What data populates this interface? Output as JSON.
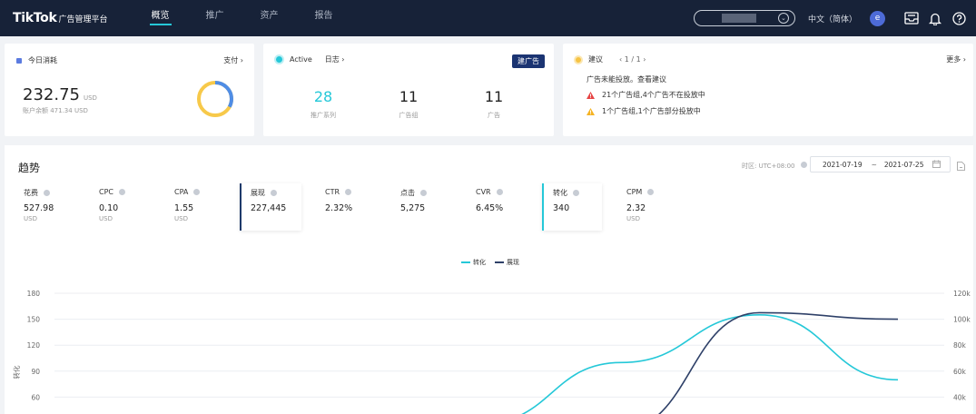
{
  "app": {
    "brand": "TikTok",
    "sub": "广告管理平台"
  },
  "nav": {
    "items": [
      {
        "label": "概览",
        "active": true
      },
      {
        "label": "推广",
        "active": false
      },
      {
        "label": "资产",
        "active": false
      },
      {
        "label": "报告",
        "active": false
      }
    ]
  },
  "topbar": {
    "language": "中文（简体）",
    "avatar_letter": "e"
  },
  "spend_card": {
    "title": "今日消耗",
    "pay_link": "支付 ›",
    "amount": "232.75",
    "unit": "USD",
    "balance": "账户余额 471.34 USD",
    "ring_fraction": 0.33
  },
  "status_card": {
    "status": "Active",
    "log_link": "日志 ›",
    "new_ad_button": "建广告",
    "metrics": [
      {
        "value": "28",
        "label": "推广系列"
      },
      {
        "value": "11",
        "label": "广告组"
      },
      {
        "value": "11",
        "label": "广告"
      }
    ]
  },
  "suggestion_card": {
    "title": "建议",
    "pager": "‹  1 / 1  ›",
    "more_link": "更多 ›",
    "message": "广告未能投放。查看建议",
    "warnings": [
      {
        "text": "21个广告组,4个广告不在投放中",
        "level": "error"
      },
      {
        "text": "1个广告组,1个广告部分投放中",
        "level": "warning"
      }
    ]
  },
  "trend": {
    "title": "趋势",
    "timezone": "时区: UTC+08:00",
    "date_start": "2021-07-19",
    "date_sep": "~",
    "date_end": "2021-07-25",
    "kpis": [
      {
        "name": "花费",
        "value": "527.98",
        "unit": "USD",
        "selected": false
      },
      {
        "name": "CPC",
        "value": "0.10",
        "unit": "USD",
        "selected": false
      },
      {
        "name": "CPA",
        "value": "1.55",
        "unit": "USD",
        "selected": false
      },
      {
        "name": "展现",
        "value": "227,445",
        "unit": "",
        "selected": true,
        "color": "#1f3a6b"
      },
      {
        "name": "CTR",
        "value": "2.32%",
        "unit": "",
        "selected": false
      },
      {
        "name": "点击",
        "value": "5,275",
        "unit": "",
        "selected": false
      },
      {
        "name": "CVR",
        "value": "6.45%",
        "unit": "",
        "selected": false
      },
      {
        "name": "转化",
        "value": "340",
        "unit": "",
        "selected": true,
        "color": "#25c8d8"
      },
      {
        "name": "CPM",
        "value": "2.32",
        "unit": "USD",
        "selected": false
      }
    ]
  },
  "colors": {
    "nav_bg": "#172238",
    "accent_cyan": "#25c8d8",
    "accent_navy": "#2e4068",
    "button_navy": "#1b3472"
  },
  "chart_data": {
    "type": "line",
    "legend": [
      "转化",
      "展现"
    ],
    "ylabel": "转化",
    "y_left_ticks": [
      "180",
      "150",
      "120",
      "90",
      "60"
    ],
    "y_right_ticks": [
      "120k",
      "100k",
      "80k",
      "60k",
      "40k"
    ],
    "y_left_range": [
      30,
      180
    ],
    "y_right_range": [
      20000,
      120000
    ],
    "x": [
      0,
      1,
      2,
      3,
      4,
      5,
      6
    ],
    "series": [
      {
        "name": "转化",
        "axis": "left",
        "color": "#25c8d8",
        "values": [
          null,
          null,
          null,
          30,
          100,
          155,
          80
        ]
      },
      {
        "name": "展现",
        "axis": "right",
        "color": "#2e4068",
        "values": [
          null,
          null,
          null,
          null,
          15000,
          105000,
          100000
        ]
      }
    ]
  }
}
